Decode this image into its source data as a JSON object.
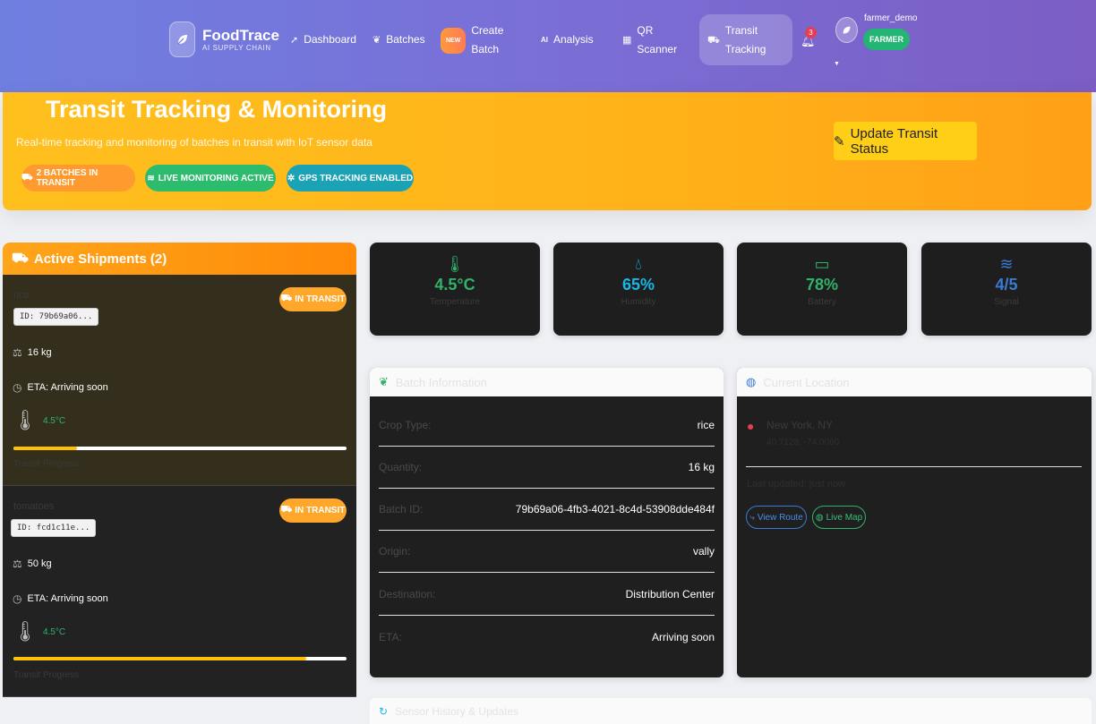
{
  "app": {
    "name": "FoodTrace",
    "tagline": "AI SUPPLY CHAIN"
  },
  "nav": {
    "dashboard": "Dashboard",
    "batches": "Batches",
    "new_badge": "NEW",
    "create_batch_l1": "Create",
    "create_batch_l2": "Batch",
    "ai_badge": "AI",
    "analysis": "Analysis",
    "qr_l1": "QR",
    "qr_l2": "Scanner",
    "transit_l1": "Transit",
    "transit_l2": "Tracking",
    "notifications_count": "3"
  },
  "user": {
    "name": "farmer_demo",
    "role": "FARMER"
  },
  "hero": {
    "title": "Transit Tracking & Monitoring",
    "subtitle": "Real-time tracking and monitoring of batches in transit with IoT sensor data",
    "chips": [
      "2 BATCHES IN TRANSIT",
      "LIVE MONITORING ACTIVE",
      "GPS TRACKING ENABLED"
    ],
    "update_button": "Update Transit Status"
  },
  "shipments": {
    "header": "Active Shipments (2)",
    "items": [
      {
        "name": "rice",
        "id": "ID: 79b69a06...",
        "status": "IN TRANSIT",
        "quantity": "16 kg",
        "eta": "ETA: Arriving soon",
        "temp": "4.5°C",
        "progress": 0.19,
        "progress_label": "Transit Progress"
      },
      {
        "name": "tomatoes",
        "id": "ID: fcd1c11e...",
        "status": "IN TRANSIT",
        "quantity": "50 kg",
        "eta": "ETA: Arriving soon",
        "temp": "4.5°C",
        "progress": 0.88,
        "progress_label": "Transit Progress"
      }
    ]
  },
  "metrics": [
    {
      "icon": "thermometer-icon",
      "value": "4.5°C",
      "label": "Temperature",
      "color": "#2fb36b"
    },
    {
      "icon": "droplet-icon",
      "value": "65%",
      "label": "Humidity",
      "color": "#19b6e6"
    },
    {
      "icon": "battery-icon",
      "value": "78%",
      "label": "Battery",
      "color": "#2fb36b"
    },
    {
      "icon": "wifi-icon",
      "value": "4/5",
      "label": "Signal",
      "color": "#3a7bd5"
    }
  ],
  "batch_info": {
    "header": "Batch Information",
    "rows": [
      {
        "k": "Crop Type:",
        "v": "rice"
      },
      {
        "k": "Quantity:",
        "v": "16 kg"
      },
      {
        "k": "Batch ID:",
        "v": "79b69a06-4fb3-4021-8c4d-53908dde484f"
      },
      {
        "k": "Origin:",
        "v": "vally"
      },
      {
        "k": "Destination:",
        "v": "Distribution Center"
      },
      {
        "k": "ETA:",
        "v": "Arriving soon"
      }
    ]
  },
  "location": {
    "header": "Current Location",
    "city": "New York, NY",
    "coords": "40.7128, -74.0060",
    "updated": "Last updated: just now",
    "view_route": "View Route",
    "live_map": "Live Map"
  },
  "bottom": {
    "header": "Sensor History & Updates"
  }
}
